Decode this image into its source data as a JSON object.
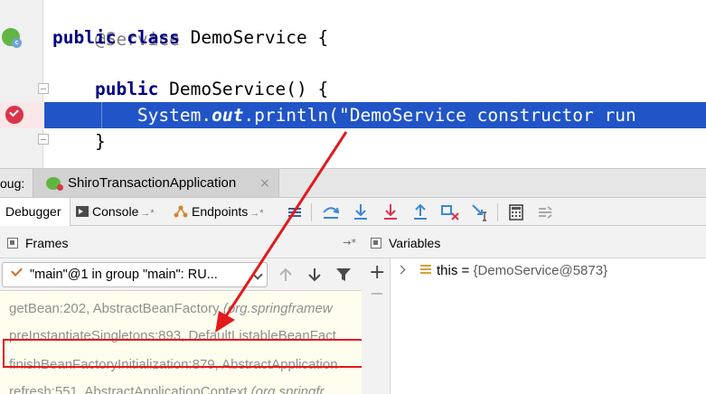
{
  "editor": {
    "lines": {
      "annotation": "@Service",
      "class_kw1": "public",
      "class_kw2": "class",
      "class_rest": " DemoService {",
      "ctor_kw": "public",
      "ctor_rest": " DemoService() {",
      "stmt_pre": "System.",
      "stmt_field": "out",
      "stmt_post": ".println(\"DemoService constructor run",
      "close_brace": "}"
    },
    "highlight_color": "#2154c7"
  },
  "debug": {
    "label": "oug:",
    "session": "ShiroTransactionApplication",
    "session_close": "×",
    "tabs": {
      "debugger": "Debugger",
      "console": "Console",
      "endpoints": "Endpoints",
      "pin": "→*"
    }
  },
  "frames": {
    "title": "Frames",
    "options_glyph": "→*",
    "thread": "\"main\"@1 in group \"main\": RU...",
    "rows": [
      {
        "method": "getBean:202, AbstractBeanFactory ",
        "pkg": "(org.springframew"
      },
      {
        "method": "preInstantiateSingletons:893, DefaultListableBeanFact",
        "pkg": ""
      },
      {
        "method": "finishBeanFactoryInitialization:879, AbstractApplication",
        "pkg": ""
      },
      {
        "method": "refresh:551, AbstractApplicationContext ",
        "pkg": "(org.springfr"
      }
    ]
  },
  "variables": {
    "title": "Variables",
    "add_glyph": "+",
    "row_name": "this",
    "row_eq": " = ",
    "row_value": "{DemoService@5873}"
  },
  "colors": {
    "annotation_arrow": "#e3191c",
    "keyword": "#000080",
    "breakpoint": "#d9344c",
    "spring_green": "#62b543"
  },
  "icons": {
    "gutter": [
      "spring-bean-icon",
      "breakpoint-icon"
    ],
    "toolbar": [
      "restore-layout-icon",
      "show-execution-point-icon",
      "step-over-icon",
      "step-into-icon",
      "force-step-into-icon",
      "step-out-icon",
      "drop-frame-icon",
      "run-to-cursor-icon",
      "evaluate-expression-icon",
      "trace-icon"
    ],
    "frames_nav": [
      "up-arrow-icon",
      "down-arrow-icon",
      "filter-icon"
    ]
  }
}
